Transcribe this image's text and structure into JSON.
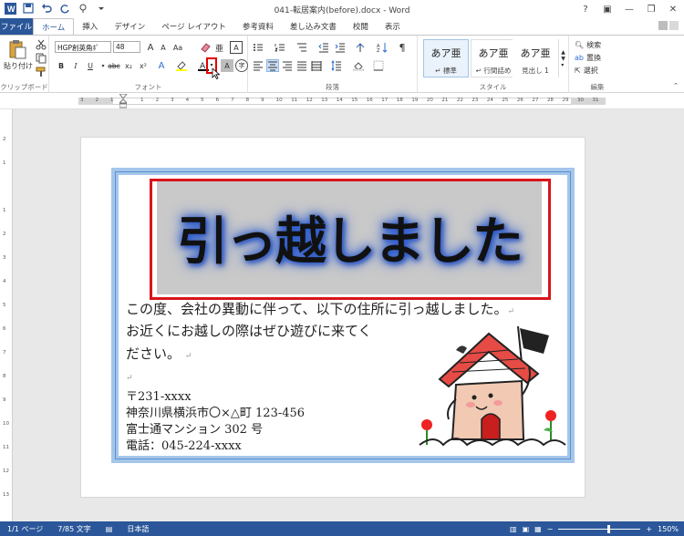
{
  "window": {
    "title": "041-転居案内(before).docx - Word",
    "help": "?",
    "controls": [
      "▣",
      "—",
      "❐",
      "✕"
    ]
  },
  "tabs": [
    "ファイル",
    "ホーム",
    "挿入",
    "デザイン",
    "ページ レイアウト",
    "参考資料",
    "差し込み文書",
    "校閲",
    "表示"
  ],
  "ribbon": {
    "clipboard": {
      "paste_label": "貼り付け",
      "group_label": "クリップボード"
    },
    "font": {
      "font_name": "HGP創英角ﾎﾟ",
      "font_size": "48",
      "group_label": "フォント",
      "buttons": [
        "B",
        "I",
        "U",
        "abc",
        "x₂",
        "x²"
      ]
    },
    "paragraph": {
      "group_label": "段落"
    },
    "styles": {
      "group_label": "スタイル",
      "items": [
        {
          "sample": "あア亜",
          "name": "↵ 標準"
        },
        {
          "sample": "あア亜",
          "name": "↵ 行間詰め"
        },
        {
          "sample": "あア亜",
          "name": "見出し 1"
        }
      ]
    },
    "editing": {
      "group_label": "編集",
      "find": "検索",
      "replace": "置換",
      "select": "選択"
    }
  },
  "ruler": {
    "numbers": [
      "3",
      "2",
      "1",
      "",
      "1",
      "2",
      "3",
      "4",
      "5",
      "6",
      "7",
      "8",
      "9",
      "10",
      "11",
      "12",
      "13",
      "14",
      "15",
      "16",
      "17",
      "18",
      "19",
      "20",
      "21",
      "22",
      "23",
      "24",
      "25",
      "26",
      "27",
      "28",
      "29",
      "30",
      "31"
    ]
  },
  "vruler": {
    "numbers": [
      "2",
      "1",
      "",
      "1",
      "2",
      "3",
      "4",
      "5",
      "6",
      "7",
      "8",
      "9",
      "10",
      "11",
      "12",
      "13"
    ]
  },
  "document": {
    "title": "引っ越しました",
    "body_lines": [
      "この度、会社の異動に伴って、以下の住所に引っ越しました。",
      "お近くにお越しの際はぜひ遊びに来てく",
      "ださい。"
    ],
    "address_lines": [
      "〒231-xxxx",
      "神奈川県横浜市〇×△町 123-456",
      "富士通マンション 302 号",
      "電話：045-224-xxxx"
    ],
    "paragraph_mark": "↵"
  },
  "status": {
    "page": "1/1 ページ",
    "words": "7/85 文字",
    "language": "日本語",
    "zoom_minus": "−",
    "zoom_plus": "+",
    "zoom": "150%",
    "zoom_level": 0.62
  }
}
